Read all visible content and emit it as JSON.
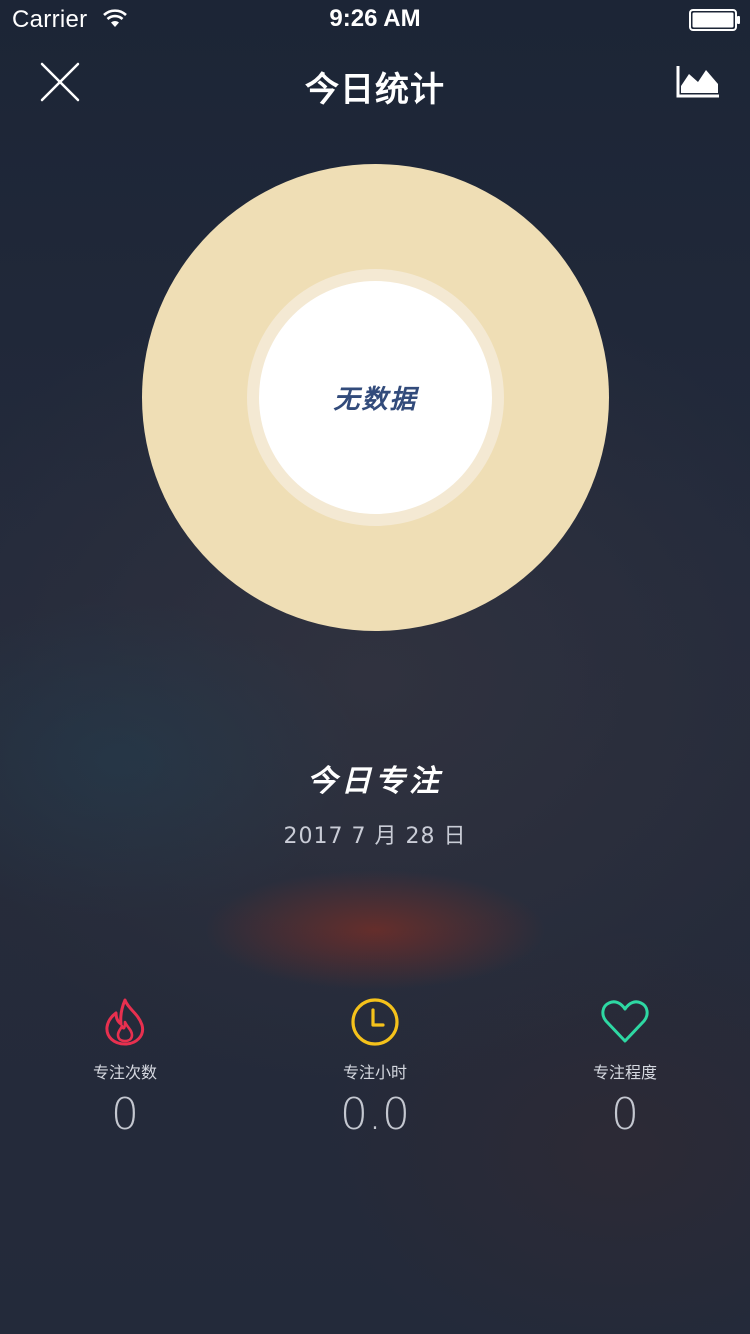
{
  "status_bar": {
    "carrier": "Carrier",
    "time": "9:26 AM"
  },
  "nav": {
    "title": "今日统计",
    "close_icon": "close-icon",
    "chart_icon": "area-chart-icon"
  },
  "donut": {
    "empty_label": "无数据",
    "colors": {
      "outer": "#efdeb5",
      "ring": "#f4e9d3",
      "center": "#ffffff",
      "label": "#324b7b"
    }
  },
  "focus": {
    "title": "今日专注",
    "date": "2017 7 月 28 日"
  },
  "stats": [
    {
      "icon": "flame-icon",
      "color": "#e8304f",
      "label": "专注次数",
      "value": "0"
    },
    {
      "icon": "clock-icon",
      "color": "#f5c21b",
      "label": "专注小时",
      "value": "0.0"
    },
    {
      "icon": "heart-icon",
      "color": "#2ed8a3",
      "label": "专注程度",
      "value": "0"
    }
  ]
}
